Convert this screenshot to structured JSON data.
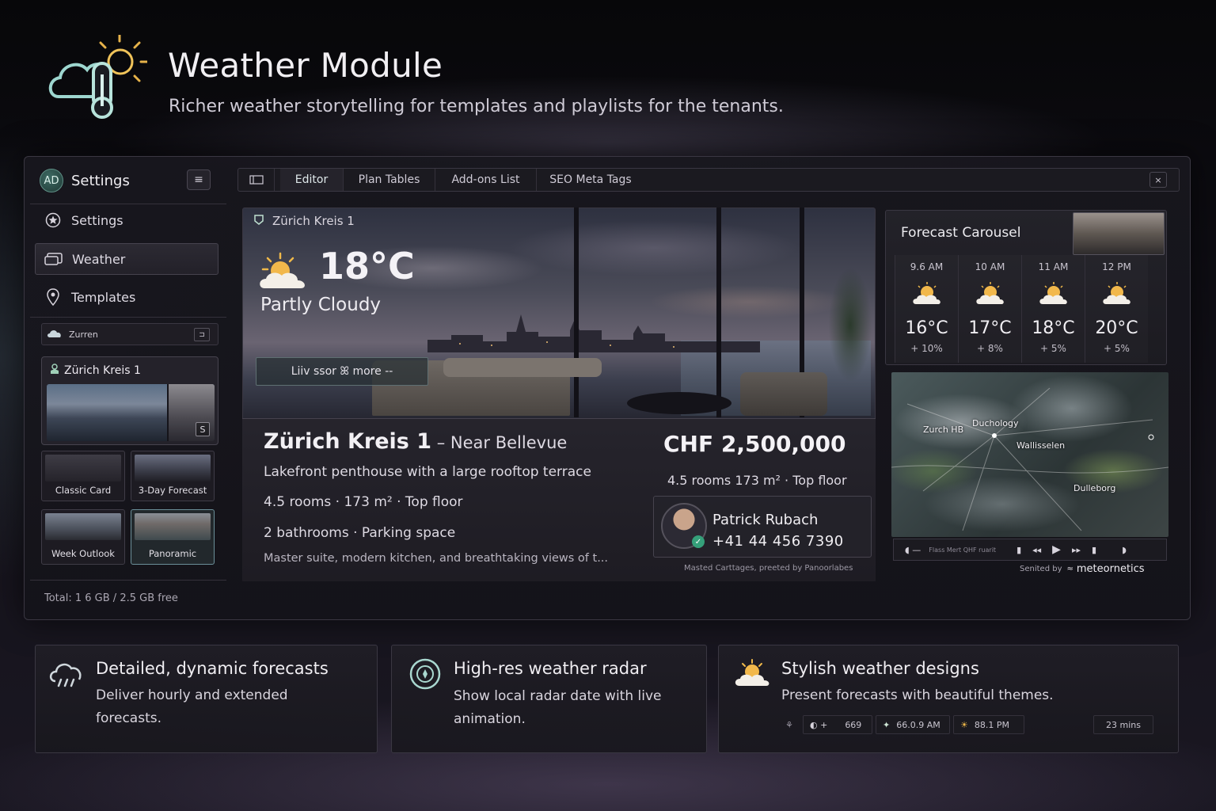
{
  "header": {
    "title": "Weather Module",
    "subtitle": "Richer weather storytelling for templates and playlists for the tenants."
  },
  "sidebar": {
    "avatar_initials": "AD",
    "title": "Settings",
    "menu_icon": "menu-icon",
    "items": [
      {
        "label": "Settings",
        "icon": "star-badge-icon"
      },
      {
        "label": "Weather",
        "icon": "weather-card-icon",
        "active": true
      },
      {
        "label": "Templates",
        "icon": "pin-icon"
      }
    ],
    "location_row": "Zurren",
    "location_card": {
      "title": "Zürich Kreis 1",
      "badge": "S"
    },
    "templates": [
      {
        "label": "Classic Card"
      },
      {
        "label": "3-Day Forecast"
      },
      {
        "label": "Week Outlook"
      },
      {
        "label": "Panoramic",
        "active": true
      }
    ],
    "storage": "Total: 1 6 GB / 2.5 GB free"
  },
  "tabs": {
    "items": [
      "Editor",
      "Plan Tables",
      "Add-ons List",
      "SEO Meta Tags"
    ],
    "active": "Editor",
    "close": "×"
  },
  "hero": {
    "location": "Zürich Kreis 1",
    "temperature": "18°C",
    "condition": "Partly Cloudy",
    "live_button": "Liiv ssor ꕤ more --"
  },
  "listing": {
    "title": "Zürich Kreis 1",
    "title_suffix": " – Near Bellevue",
    "headline": "Lakefront penthouse with a large rooftop terrace",
    "rooms_line": "4.5 rooms  ·  173 m²  ·  Top floor",
    "extras_line": "2 bathrooms  ·  Parking space",
    "description": "Master suite, modern kitchen, and breathtaking views of t...",
    "price": "CHF 2,500,000",
    "price_meta": "4.5 rooms  173 m² · Top floor",
    "agent": {
      "name": "Patrick Rubach",
      "phone": "+41 44 456 7390"
    },
    "credit": "Masted Carttages, preeted by Panoorlabes"
  },
  "forecast": {
    "title": "Forecast Carousel",
    "slots": [
      {
        "time": "9.6 AM",
        "temp": "16°C",
        "pop": "+ 10%"
      },
      {
        "time": "10 AM",
        "temp": "17°C",
        "pop": "+ 8%"
      },
      {
        "time": "11 AM",
        "temp": "18°C",
        "pop": "+ 5%"
      },
      {
        "time": "12 PM",
        "temp": "20°C",
        "pop": "+ 5%"
      }
    ]
  },
  "radar": {
    "labels": [
      "Zurch HB",
      "Duchology",
      "Wallisselen",
      "Dulleborg"
    ],
    "controls_text": "Flass Mert QHF ruarit",
    "powered_prefix": "Senited by",
    "powered_brand": "meteornetics"
  },
  "features": [
    {
      "title": "Detailed, dynamic forecasts",
      "desc": "Deliver hourly and extended forecasts.",
      "icon": "cloud-rain-icon"
    },
    {
      "title": "High-res weather radar",
      "desc": "Show local radar date with live animation.",
      "icon": "radar-icon"
    },
    {
      "title": "Stylish weather designs",
      "desc": "Present forecasts with beautiful themes.",
      "icon": "sun-cloud-icon",
      "stats": [
        {
          "icon": "wind-icon",
          "value": ""
        },
        {
          "icon": "humidity-icon",
          "value": "669"
        },
        {
          "icon": "sunrise-icon",
          "value": "66.0.9 AM"
        },
        {
          "icon": "sunset-icon",
          "value": "88.1 PM"
        },
        {
          "icon": "",
          "value": "23 mins"
        }
      ]
    }
  ]
}
